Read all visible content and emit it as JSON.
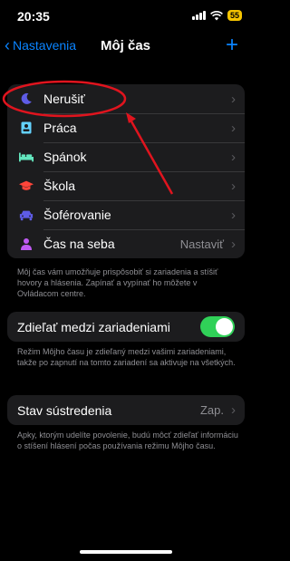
{
  "status_bar": {
    "time": "20:35",
    "battery": "55"
  },
  "nav": {
    "back_label": "Nastavenia",
    "title": "Môj čas",
    "add_label": "+"
  },
  "focus_modes": [
    {
      "label": "Nerušiť",
      "icon": "moon-icon",
      "value": ""
    },
    {
      "label": "Práca",
      "icon": "id-badge-icon",
      "value": ""
    },
    {
      "label": "Spánok",
      "icon": "bed-icon",
      "value": ""
    },
    {
      "label": "Škola",
      "icon": "graduation-cap-icon",
      "value": ""
    },
    {
      "label": "Šoférovanie",
      "icon": "car-icon",
      "value": ""
    },
    {
      "label": "Čas na seba",
      "icon": "person-icon",
      "value": "Nastaviť"
    }
  ],
  "focus_footnote": "Môj čas vám umožňuje prispôsobiť si zariadenia a stíšiť hovory a hlásenia. Zapínať a vypínať ho môžete v Ovládacom centre.",
  "share": {
    "label": "Zdieľať medzi zariadeniami",
    "enabled": true
  },
  "share_footnote": "Režim Môjho času je zdieľaný medzi vašimi zariadeniami, takže po zapnutí na tomto zariadení sa aktivuje na všetkých.",
  "focus_status": {
    "label": "Stav sústredenia",
    "value": "Zap."
  },
  "status_footnote": "Apky, ktorým udelíte povolenie, budú môcť zdieľať informáciu o stíšení hlásení počas používania režimu Môjho času.",
  "colors": {
    "accent": "#0a84ff",
    "toggle_on": "#30d158",
    "annotation": "#e0141e",
    "moon": "#5e5ce6",
    "work": "#64d2ff",
    "sleep": "#63e6be",
    "school": "#ff453a",
    "driving": "#5e5ce6",
    "personal": "#bf5af2"
  }
}
